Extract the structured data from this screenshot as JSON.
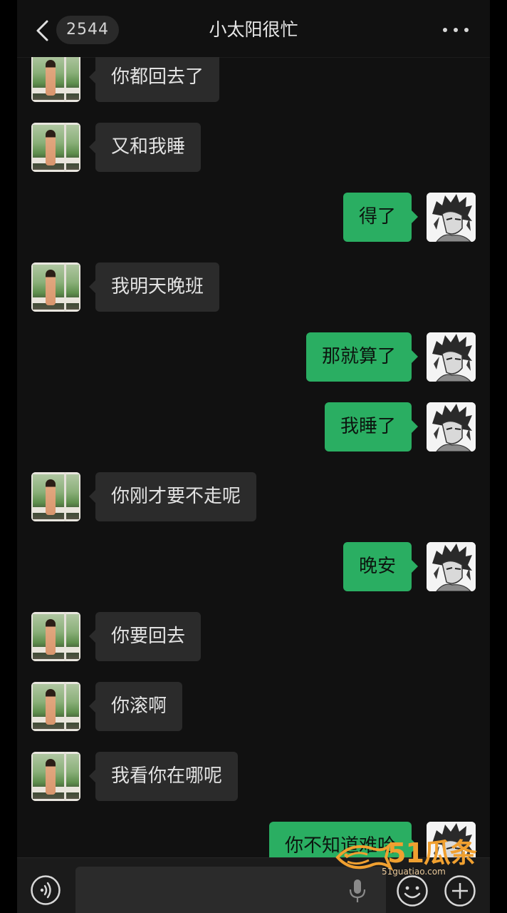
{
  "header": {
    "unread_count": "2544",
    "title": "小太阳很忙"
  },
  "messages": [
    {
      "side": "left",
      "text": "你都回去了"
    },
    {
      "side": "left",
      "text": "又和我睡"
    },
    {
      "side": "right",
      "text": "得了"
    },
    {
      "side": "left",
      "text": "我明天晚班"
    },
    {
      "side": "right",
      "text": "那就算了"
    },
    {
      "side": "right",
      "text": "我睡了"
    },
    {
      "side": "left",
      "text": "你刚才要不走呢"
    },
    {
      "side": "right",
      "text": "晚安"
    },
    {
      "side": "left",
      "text": "你要回去"
    },
    {
      "side": "left",
      "text": "你滚啊"
    },
    {
      "side": "left",
      "text": "我看你在哪呢"
    },
    {
      "side": "right",
      "text": "你不知道难哈"
    }
  ],
  "input": {
    "value": "",
    "placeholder": ""
  },
  "watermark": {
    "brand": "51瓜条",
    "domain": "51guatiao.com"
  },
  "colors": {
    "background": "#111111",
    "outgoing_bubble": "#2aae62",
    "incoming_bubble": "#2b2b2b",
    "watermark": "#f0a030"
  },
  "icons": {
    "back": "chevron-left-icon",
    "more": "more-dots-icon",
    "voice": "voice-wave-icon",
    "mic": "mic-icon",
    "emoji": "emoji-icon",
    "plus": "plus-icon"
  }
}
